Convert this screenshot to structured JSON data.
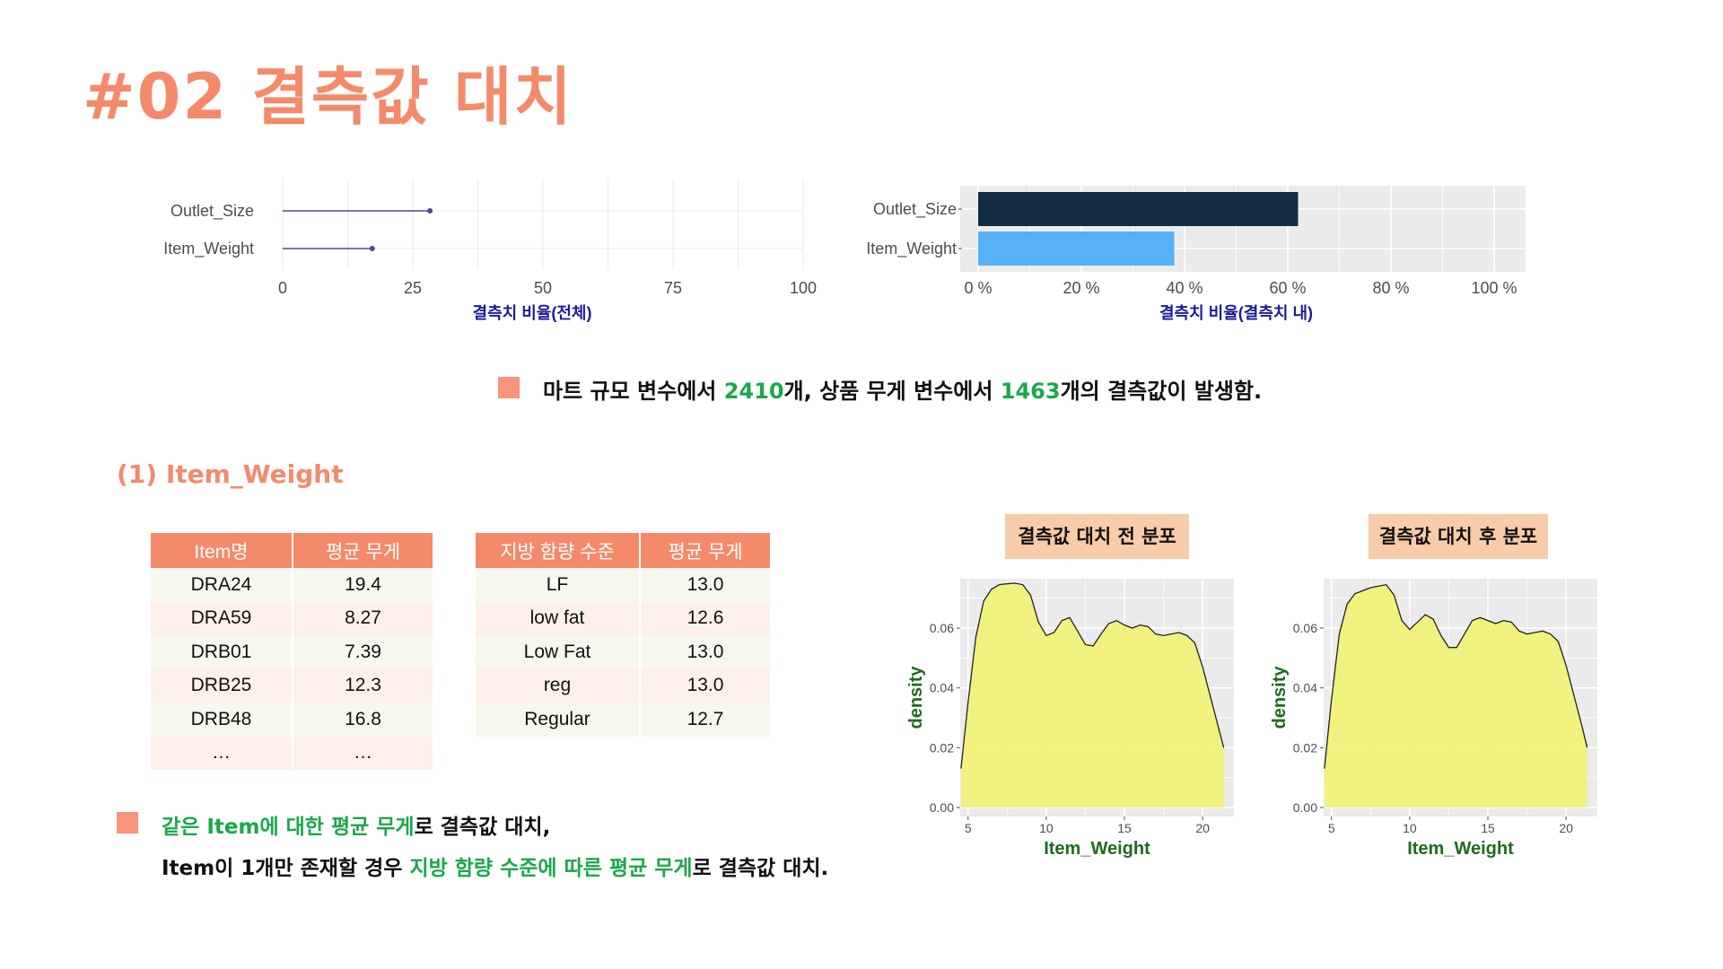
{
  "page_title": "#02  결측값 대치",
  "chart_data": [
    {
      "type": "scatter",
      "categories": [
        "Outlet_Size",
        "Item_Weight"
      ],
      "values": [
        28.3,
        17.2
      ],
      "xlabel": "결측치 비율(전체)",
      "xlim": [
        0,
        100
      ],
      "xticks": [
        "0",
        "25",
        "50",
        "75",
        "100"
      ],
      "color": "#4a4a8c"
    },
    {
      "type": "bar",
      "categories": [
        "Outlet_Size",
        "Item_Weight"
      ],
      "values": [
        62,
        38
      ],
      "xlabel": "결측치 비율(결측치 내)",
      "xlim": [
        0,
        100
      ],
      "xticks": [
        "0 %",
        "20 %",
        "40 %",
        "60 %",
        "80 %",
        "100 %"
      ],
      "colors": [
        "#132b43",
        "#56b1f7"
      ]
    },
    {
      "type": "area",
      "title": "결측값 대치 전 분포",
      "xlabel": "Item_Weight",
      "ylabel": "density",
      "xlim": [
        4.5,
        22.0
      ],
      "ylim": [
        0,
        0.075
      ],
      "xticks": [
        "5",
        "10",
        "15",
        "20"
      ],
      "yticks": [
        "0.00",
        "0.02",
        "0.04",
        "0.06"
      ],
      "x": [
        4.55,
        5.0,
        5.5,
        6.0,
        6.5,
        7.0,
        7.5,
        8.0,
        8.5,
        9.0,
        9.5,
        10.0,
        10.5,
        11.0,
        11.5,
        12.0,
        12.5,
        13.0,
        13.5,
        14.0,
        14.5,
        15.0,
        15.5,
        16.0,
        16.5,
        17.0,
        17.5,
        18.0,
        18.5,
        19.0,
        19.5,
        20.0,
        20.5,
        21.0,
        21.35
      ],
      "y": [
        0.013,
        0.035,
        0.057,
        0.069,
        0.073,
        0.0745,
        0.0748,
        0.075,
        0.0745,
        0.071,
        0.062,
        0.0575,
        0.0585,
        0.0625,
        0.0635,
        0.059,
        0.0545,
        0.054,
        0.058,
        0.0615,
        0.0625,
        0.061,
        0.06,
        0.061,
        0.0605,
        0.058,
        0.0575,
        0.058,
        0.0585,
        0.0575,
        0.055,
        0.047,
        0.037,
        0.027,
        0.02
      ],
      "fill": "#f2f273",
      "axis_label_color": "#1e6b1e"
    },
    {
      "type": "area",
      "title": "결측값 대치 후 분포",
      "xlabel": "Item_Weight",
      "ylabel": "density",
      "xlim": [
        4.5,
        22.0
      ],
      "ylim": [
        0,
        0.075
      ],
      "xticks": [
        "5",
        "10",
        "15",
        "20"
      ],
      "yticks": [
        "0.00",
        "0.02",
        "0.04",
        "0.06"
      ],
      "x": [
        4.55,
        5.0,
        5.5,
        6.0,
        6.5,
        7.0,
        7.5,
        8.0,
        8.5,
        9.0,
        9.5,
        10.0,
        10.5,
        11.0,
        11.5,
        12.0,
        12.5,
        13.0,
        13.5,
        14.0,
        14.5,
        15.0,
        15.5,
        16.0,
        16.5,
        17.0,
        17.5,
        18.0,
        18.5,
        19.0,
        19.5,
        20.0,
        20.5,
        21.0,
        21.35
      ],
      "y": [
        0.013,
        0.036,
        0.058,
        0.068,
        0.0715,
        0.0725,
        0.0735,
        0.074,
        0.0745,
        0.071,
        0.0625,
        0.0595,
        0.062,
        0.0645,
        0.063,
        0.0575,
        0.0535,
        0.0535,
        0.058,
        0.0625,
        0.0635,
        0.0625,
        0.0615,
        0.0625,
        0.062,
        0.059,
        0.058,
        0.0585,
        0.059,
        0.058,
        0.0555,
        0.0475,
        0.0375,
        0.0275,
        0.02
      ],
      "fill": "#f2f273",
      "axis_label_color": "#1e6b1e"
    }
  ],
  "summary": {
    "p1": "마트 규모 변수에서 ",
    "v1": "2410",
    "p2": "개, 상품 무게 변수에서 ",
    "v2": "1463",
    "p3": "개의 결측값이 발생함."
  },
  "subheading": "(1) Item_Weight",
  "table1": {
    "headers": [
      "Item명",
      "평균 무게"
    ],
    "rows": [
      [
        "DRA24",
        "19.4"
      ],
      [
        "DRA59",
        "8.27"
      ],
      [
        "DRB01",
        "7.39"
      ],
      [
        "DRB25",
        "12.3"
      ],
      [
        "DRB48",
        "16.8"
      ],
      [
        "…",
        "…"
      ]
    ]
  },
  "table2": {
    "headers": [
      "지방 함량 수준",
      "평균 무게"
    ],
    "rows": [
      [
        "LF",
        "13.0"
      ],
      [
        "low fat",
        "12.6"
      ],
      [
        "Low Fat",
        "13.0"
      ],
      [
        "reg",
        "13.0"
      ],
      [
        "Regular",
        "12.7"
      ]
    ]
  },
  "bottom_note": {
    "l1_green": "같은 Item에 대한 평균 무게",
    "l1_rest": "로 결측값 대치,",
    "l2_a": "Item이 1개만 존재할 경우 ",
    "l2_green": "지방 함량 수준에 따른 평균 무게",
    "l2_rest": "로 결측값 대치."
  }
}
